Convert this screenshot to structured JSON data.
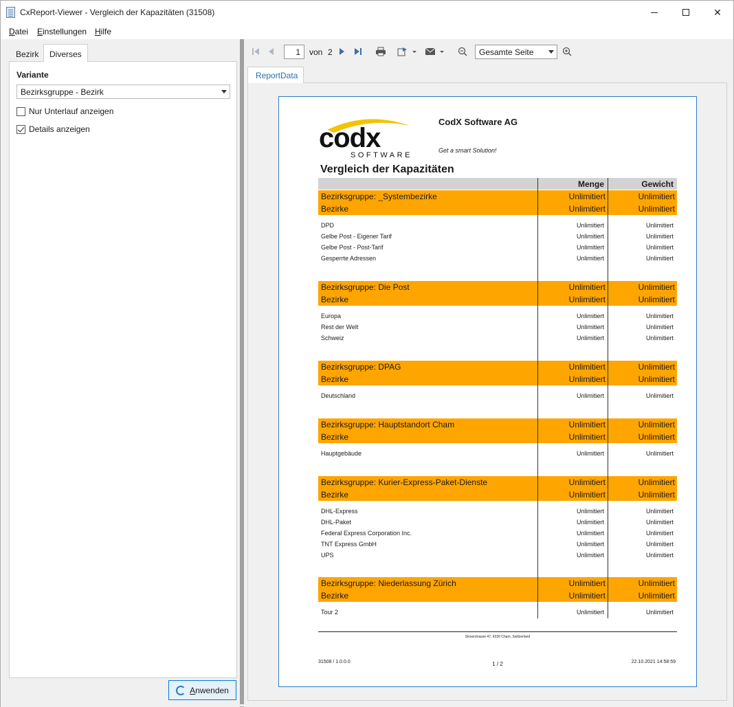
{
  "window": {
    "title": "CxReport-Viewer - Vergleich der Kapazitäten (31508)"
  },
  "menu": {
    "items": [
      {
        "label_u": "D",
        "label_rest": "atei"
      },
      {
        "label_u": "E",
        "label_rest": "instellungen"
      },
      {
        "label_u": "H",
        "label_rest": "ilfe"
      }
    ]
  },
  "left": {
    "tabs": [
      "Bezirk",
      "Diverses"
    ],
    "variante_label": "Variante",
    "variante_value": "Bezirksgruppe - Bezirk",
    "checkboxes": [
      {
        "label": "Nur Unterlauf anzeigen",
        "checked": false
      },
      {
        "label": "Details anzeigen",
        "checked": true
      }
    ],
    "apply_u": "A",
    "apply_rest": "nwenden"
  },
  "toolbar": {
    "page_current": "1",
    "von": "von",
    "page_total": "2",
    "zoom_value": "Gesamte Seite",
    "icons": [
      "first-page-icon",
      "prev-page-icon",
      "next-page-icon",
      "last-page-icon",
      "print-icon",
      "export-icon",
      "mail-icon",
      "zoom-out-icon",
      "zoom-in-icon"
    ]
  },
  "doc_tab": "ReportData",
  "report": {
    "company": "CodX Software AG",
    "slogan": "Get a smart Solution!",
    "logo_text": "codx",
    "logo_sub": "SOFTWARE",
    "title": "Vergleich der Kapazitäten",
    "col_menge": "Menge",
    "col_gewicht": "Gewicht",
    "highlight_color": "#ffa500",
    "groups": [
      {
        "name": "Bezirksgruppe: _Systembezirke",
        "menge": "Unlimitiert",
        "gewicht": "Unlimitiert",
        "sub": "Bezirke",
        "sub_menge": "Unlimitiert",
        "sub_gewicht": "Unlimitiert",
        "details": [
          {
            "name": "DPD",
            "menge": "Unlimitiert",
            "gewicht": "Unlimitiert"
          },
          {
            "name": "Gelbe Post - Eigener Tarif",
            "menge": "Unlimitiert",
            "gewicht": "Unlimitiert"
          },
          {
            "name": "Gelbe Post - Post-Tarif",
            "menge": "Unlimitiert",
            "gewicht": "Unlimitiert"
          },
          {
            "name": "Gesperrte Adressen",
            "menge": "Unlimitiert",
            "gewicht": "Unlimitiert"
          }
        ]
      },
      {
        "name": "Bezirksgruppe: Die Post",
        "menge": "Unlimitiert",
        "gewicht": "Unlimitiert",
        "sub": "Bezirke",
        "sub_menge": "Unlimitiert",
        "sub_gewicht": "Unlimitiert",
        "details": [
          {
            "name": "Europa",
            "menge": "Unlimitiert",
            "gewicht": "Unlimitiert"
          },
          {
            "name": "Rest der Welt",
            "menge": "Unlimitiert",
            "gewicht": "Unlimitiert"
          },
          {
            "name": "Schweiz",
            "menge": "Unlimitiert",
            "gewicht": "Unlimitiert"
          }
        ]
      },
      {
        "name": "Bezirksgruppe: DPAG",
        "menge": "Unlimitiert",
        "gewicht": "Unlimitiert",
        "sub": "Bezirke",
        "sub_menge": "Unlimitiert",
        "sub_gewicht": "Unlimitiert",
        "details": [
          {
            "name": "Deutschland",
            "menge": "Unlimitiert",
            "gewicht": "Unlimitiert"
          }
        ]
      },
      {
        "name": "Bezirksgruppe: Hauptstandort Cham",
        "menge": "Unlimitiert",
        "gewicht": "Unlimitiert",
        "sub": "Bezirke",
        "sub_menge": "Unlimitiert",
        "sub_gewicht": "Unlimitiert",
        "details": [
          {
            "name": "Hauptgebäude",
            "menge": "Unlimitiert",
            "gewicht": "Unlimitiert"
          }
        ]
      },
      {
        "name": "Bezirksgruppe: Kurier-Express-Paket-Dienste",
        "menge": "Unlimitiert",
        "gewicht": "Unlimitiert",
        "sub": "Bezirke",
        "sub_menge": "Unlimitiert",
        "sub_gewicht": "Unlimitiert",
        "details": [
          {
            "name": "DHL-Express",
            "menge": "Unlimitiert",
            "gewicht": "Unlimitiert"
          },
          {
            "name": "DHL-Paket",
            "menge": "Unlimitiert",
            "gewicht": "Unlimitiert"
          },
          {
            "name": "Federal Express Corporation Inc.",
            "menge": "Unlimitiert",
            "gewicht": "Unlimitiert"
          },
          {
            "name": "TNT Express GmbH",
            "menge": "Unlimitiert",
            "gewicht": "Unlimitiert"
          },
          {
            "name": "UPS",
            "menge": "Unlimitiert",
            "gewicht": "Unlimitiert"
          }
        ]
      },
      {
        "name": "Bezirksgruppe: Niederlassung Zürich",
        "menge": "Unlimitiert",
        "gewicht": "Unlimitiert",
        "sub": "Bezirke",
        "sub_menge": "Unlimitiert",
        "sub_gewicht": "Unlimitiert",
        "details": [
          {
            "name": "Tour 2",
            "menge": "Unlimitiert",
            "gewicht": "Unlimitiert"
          }
        ]
      }
    ],
    "footer_address": "Sinserstrasse 47, 6330 Cham, Switzerland",
    "footer_left": "31508 / 1.0.0.0",
    "footer_page": "1 / 2",
    "footer_right": "22.10.2021 14:58:59"
  }
}
